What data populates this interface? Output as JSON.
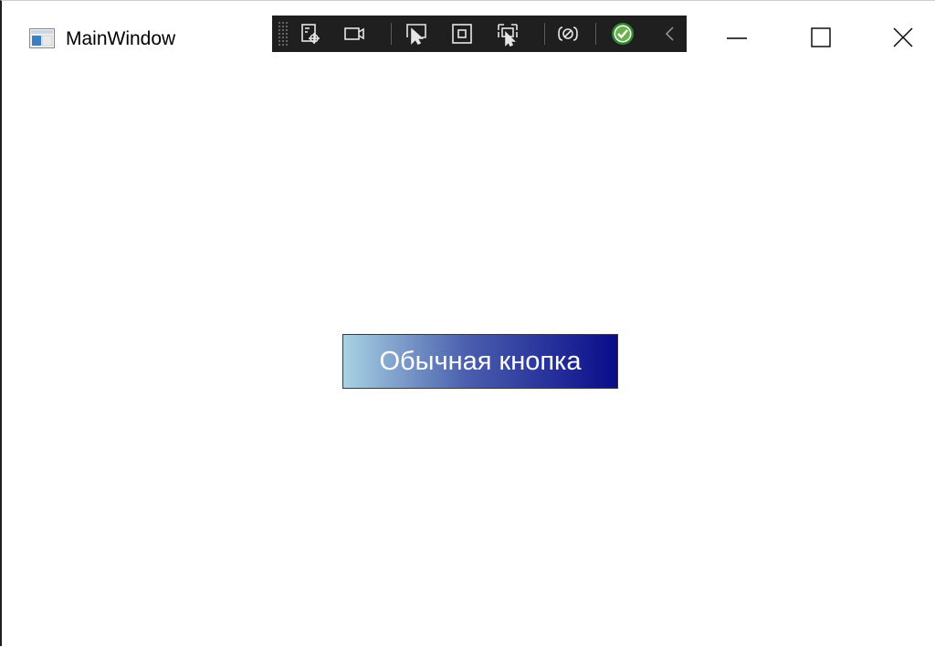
{
  "window": {
    "title": "MainWindow"
  },
  "devtools_toolbar": {
    "tools": [
      {
        "icon": "live-visual-tree-icon"
      },
      {
        "icon": "video-camera-icon"
      },
      {
        "icon": "select-element-icon"
      },
      {
        "icon": "display-layout-adorners-icon"
      },
      {
        "icon": "track-focused-element-icon"
      },
      {
        "icon": "binding-failures-icon"
      },
      {
        "icon": "hot-reload-status-icon"
      },
      {
        "icon": "collapse-chevron-icon"
      }
    ],
    "colors": {
      "background": "#1f1f1f",
      "icon": "#e6e6e6",
      "status_ok": "#6ab04c"
    }
  },
  "window_controls": {
    "minimize": "minimize-icon",
    "maximize": "maximize-icon",
    "close": "close-icon"
  },
  "main": {
    "button_label": "Обычная кнопка",
    "button_gradient": [
      "#a8d2e2",
      "#4a5fae",
      "#0a0c8a"
    ]
  }
}
